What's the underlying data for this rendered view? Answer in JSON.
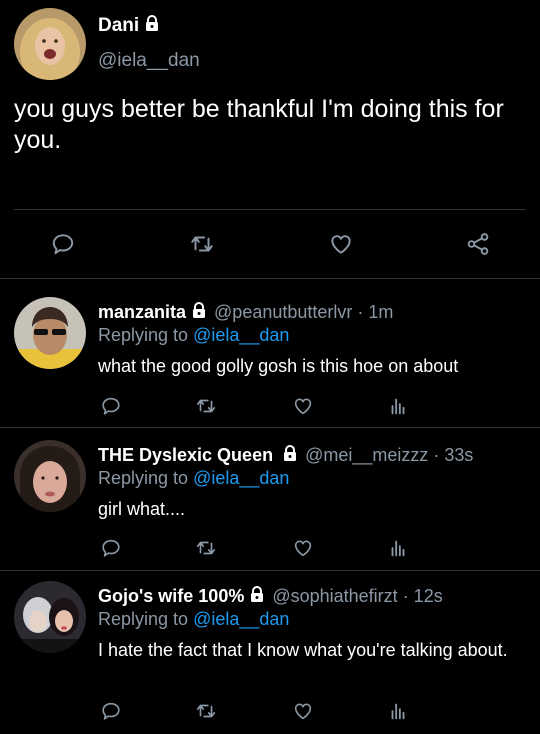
{
  "main_tweet": {
    "display_name": "Dani",
    "handle": "@iela__dan",
    "text": "you guys better be thankful I'm doing this for you.",
    "icons": [
      "reply-icon",
      "retweet-icon",
      "like-icon",
      "share-icon"
    ]
  },
  "replies": [
    {
      "display_name": "manzanita",
      "handle": "@peanutbutterlvr",
      "time": "· 1m",
      "replying_prefix": "Replying to",
      "replying_to": "@iela__dan",
      "text": "what the good golly gosh is this hoe on about"
    },
    {
      "display_name": "THE Dyslexic Queen",
      "handle": "@mei__meizzz",
      "time": "· 33s",
      "replying_prefix": "Replying to",
      "replying_to": "@iela__dan",
      "text": "girl what...."
    },
    {
      "display_name": "Gojo's wife 100%",
      "handle": "@sophiathefirzt",
      "time": "· 12s",
      "replying_prefix": "Replying to",
      "replying_to": "@iela__dan",
      "text": "I hate the fact that I know what you're talking about."
    }
  ],
  "colors": {
    "background": "#000000",
    "text": "#ffffff",
    "muted": "#8b98a5",
    "link": "#1d9bf0",
    "divider": "#2f3336"
  }
}
